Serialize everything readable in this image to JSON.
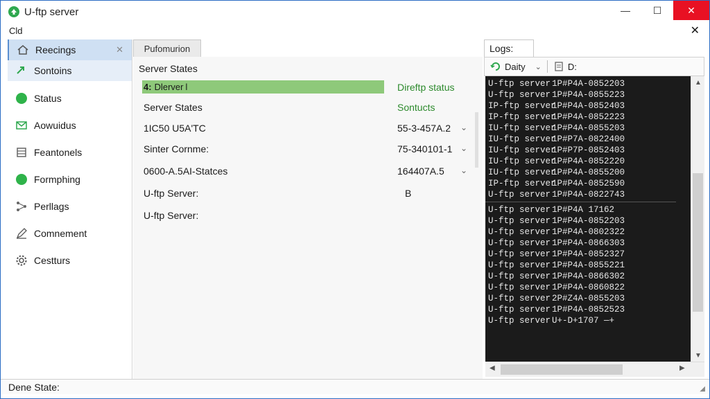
{
  "window": {
    "title": "U-ftp server",
    "minimize": "—",
    "maximize": "☐",
    "close": "✕"
  },
  "menu": {
    "label": "Cld",
    "close": "✕"
  },
  "sidebar": {
    "items": [
      {
        "label": "Reecings",
        "icon": "home-icon",
        "close": "✕"
      },
      {
        "label": "Sontoins",
        "icon": "arrow-icon"
      },
      {
        "label": "Status",
        "icon": "green-dot-icon"
      },
      {
        "label": "Aowuidus",
        "icon": "envelope-icon"
      },
      {
        "label": "Feantonels",
        "icon": "panel-icon"
      },
      {
        "label": "Formphing",
        "icon": "green-dot-icon"
      },
      {
        "label": "Perllags",
        "icon": "network-icon"
      },
      {
        "label": "Comnement",
        "icon": "pencil-icon"
      },
      {
        "label": "Cestturs",
        "icon": "gear-icon"
      }
    ]
  },
  "center": {
    "tab": "Pufomurion",
    "heading": "Server States",
    "selected_row": {
      "mark": "4:",
      "label": "Dlerver",
      "suffix": "l"
    },
    "rows": [
      {
        "label": "",
        "value": "Direftp status",
        "value_color": "green"
      },
      {
        "label": "Server States",
        "value": "Sontucts",
        "value_color": "green"
      },
      {
        "label": "1IC50 U5A'TC",
        "value": "55-3-457A.2",
        "chevron": "⌄"
      },
      {
        "label": "Sinter Cornme:",
        "value": "75-340101-1",
        "chevron": "⌄"
      },
      {
        "label": "0600-A.5AI-Statces",
        "value": "164407A.5",
        "chevron": "⌄"
      },
      {
        "label": "U-ftp Server:",
        "value": "B"
      },
      {
        "label": "U-ftp Server:",
        "value": ""
      }
    ]
  },
  "logs": {
    "tab": "Logs:",
    "toolbar": {
      "filter": "Daity",
      "column": "D:"
    },
    "lines_top": [
      {
        "src": "U-ftp server",
        "ts": "1P#P4A-0852203"
      },
      {
        "src": "U-ftp server",
        "ts": "1P#P4A-0855223"
      },
      {
        "src": "IP-ftp server",
        "ts": "1P#P4A-0852403"
      },
      {
        "src": "IP-ftp server",
        "ts": "1P#P4A-0852223"
      },
      {
        "src": "IU-ftp server",
        "ts": "1P#P4A-0855203"
      },
      {
        "src": "IU-ftp server",
        "ts": "1P#P7A-0822400"
      },
      {
        "src": "IU-ftp server",
        "ts": "1P#P7P-0852403"
      },
      {
        "src": "IU-ftp server",
        "ts": "1P#P4A-0852220"
      },
      {
        "src": "IU-ftp server",
        "ts": "1P#P4A-0855200"
      },
      {
        "src": "IP-ftp server",
        "ts": "1P#P4A-0852590"
      },
      {
        "src": "U-ftp server",
        "ts": "1P#P4A-0822743"
      }
    ],
    "lines_bottom": [
      {
        "src": "U-ftp server",
        "ts": "1P#P4A 17162"
      },
      {
        "src": "U-ftp server",
        "ts": "1P#P4A-0852203"
      },
      {
        "src": "U-ftp server",
        "ts": "1P#P4A-0802322"
      },
      {
        "src": "U-ftp server",
        "ts": "1P#P4A-0866303"
      },
      {
        "src": "U-ftp server",
        "ts": "1P#P4A-0852327"
      },
      {
        "src": "U-ftp server",
        "ts": "1P#P4A-0855221"
      },
      {
        "src": "U-ftp server",
        "ts": "1P#P4A-0866302"
      },
      {
        "src": "U-ftp server",
        "ts": "1P#P4A-0860822"
      },
      {
        "src": "U-ftp server",
        "ts": "2P#Z4A-0855203"
      },
      {
        "src": "U-ftp server",
        "ts": "1P#P4A-0852523"
      },
      {
        "src": "U-ftp server",
        "ts": "U+-D+1707 —+"
      }
    ]
  },
  "statusbar": {
    "text": "Dene State:"
  },
  "colors": {
    "accent": "#2a6cc4",
    "selected": "#8ec97a",
    "status_green": "#2fb34a",
    "close_red": "#e81123",
    "log_bg": "#1b1b1b"
  }
}
